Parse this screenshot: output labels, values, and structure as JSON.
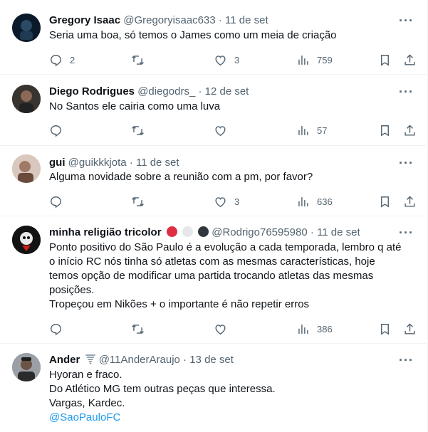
{
  "tweets": [
    {
      "name": "Gregory Isaac",
      "handle": "@Gregoryisaac633",
      "time": "11 de set",
      "lines": [
        "Seria uma boa, só temos o James como um meia de criação"
      ],
      "replies": "2",
      "retweets": "",
      "likes": "3",
      "views": "759"
    },
    {
      "name": "Diego Rodrigues",
      "handle": "@diegodrs_",
      "time": "12 de set",
      "lines": [
        "No Santos ele cairia como uma luva"
      ],
      "replies": "",
      "retweets": "",
      "likes": "",
      "views": "57"
    },
    {
      "name": "gui",
      "handle": "@guikkkjota",
      "time": "11 de set",
      "lines": [
        "Alguma novidade sobre a reunião com a pm, por favor?"
      ],
      "replies": "",
      "retweets": "",
      "likes": "3",
      "views": "636"
    },
    {
      "name": "minha religião tricolor",
      "handle": "@Rodrigo76595980",
      "time": "11 de set",
      "lines": [
        "Ponto positivo do São Paulo é a evolução a cada temporada, lembro q até",
        "o início RC nós tinha só atletas com as mesmas características, hoje",
        "temos opção de modificar uma partida trocando atletas das mesmas",
        "posições.",
        "Tropeçou em Nikões + o importante é não repetir erros"
      ],
      "replies": "",
      "retweets": "",
      "likes": "",
      "views": "386"
    },
    {
      "name": "Ander",
      "handle": "@11AnderAraujo",
      "time": "13 de set",
      "lines": [
        "Hyoran e fraco.",
        "Do Atlético MG tem outras peças que interessa.",
        "Vargas, Kardec."
      ],
      "mention": "@SaoPauloFC"
    }
  ],
  "separator": "·",
  "colors": {
    "text": "#0f1419",
    "secondary": "#536471",
    "link": "#1d9bf0",
    "border": "#eff3f4"
  },
  "icons": [
    "reply-icon",
    "retweet-icon",
    "like-icon",
    "views-icon",
    "bookmark-icon",
    "share-icon",
    "more-icon"
  ]
}
